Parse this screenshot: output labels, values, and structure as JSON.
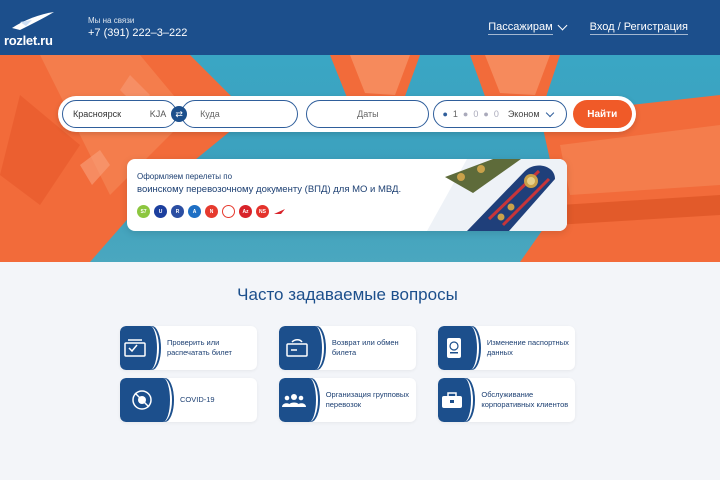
{
  "header": {
    "logo_text": "rozlet.ru",
    "contact_label": "Мы на связи",
    "phone": "+7 (391) 222–3–222",
    "nav": [
      {
        "label": "Пассажирам",
        "has_dropdown": true
      },
      {
        "label": "Вход / Регистрация",
        "has_dropdown": false
      }
    ]
  },
  "search": {
    "from_city": "Красноярск",
    "from_code": "KJA",
    "to_placeholder": "Куда",
    "dates_placeholder": "Даты",
    "passengers": {
      "adults": "1",
      "children": "0",
      "infants": "0"
    },
    "travel_class": "Эконом",
    "submit_label": "Найти"
  },
  "banner": {
    "line1": "Оформляем перелеты по",
    "line2": "воинскому перевозочному документу (ВПД) для МО и МВД.",
    "airlines": [
      {
        "icon": "s7-airline-icon",
        "color": "#8cc63f",
        "text": "S7"
      },
      {
        "icon": "ural-airline-icon",
        "color": "#1c3f9e",
        "text": "U"
      },
      {
        "icon": "rossiya-airline-icon",
        "color": "#2b4ea2",
        "text": "R"
      },
      {
        "icon": "aeroflot-airline-icon",
        "color": "#1e6fc4",
        "text": "A"
      },
      {
        "icon": "nordwind-airline-icon",
        "color": "#e63a2e",
        "text": "N"
      },
      {
        "icon": "pobeda-airline-icon",
        "color": "#ffffff",
        "text": ""
      },
      {
        "icon": "azimuth-airline-icon",
        "color": "#d8232a",
        "text": "Az"
      },
      {
        "icon": "nordstar-airline-icon",
        "color": "#e4322b",
        "text": "NS"
      },
      {
        "icon": "redwings-airline-icon",
        "color": "#ffffff",
        "text": ""
      }
    ]
  },
  "faq": {
    "title": "Часто задаваемые вопросы",
    "items": [
      {
        "label": "Проверить или распечатать билет",
        "icon": "ticket-check-icon"
      },
      {
        "label": "Возврат или обмен билета",
        "icon": "ticket-return-icon"
      },
      {
        "label": "Изменение паспортных данных",
        "icon": "passport-icon"
      },
      {
        "label": "COVID-19",
        "icon": "virus-icon"
      },
      {
        "label": "Организация групповых перевозок",
        "icon": "group-icon"
      },
      {
        "label": "Обслуживание корпоративных клиентов",
        "icon": "briefcase-icon"
      }
    ]
  },
  "colors": {
    "brand": "#1c4f8c",
    "accent": "#f05a28",
    "plane": "#f26b3a"
  }
}
